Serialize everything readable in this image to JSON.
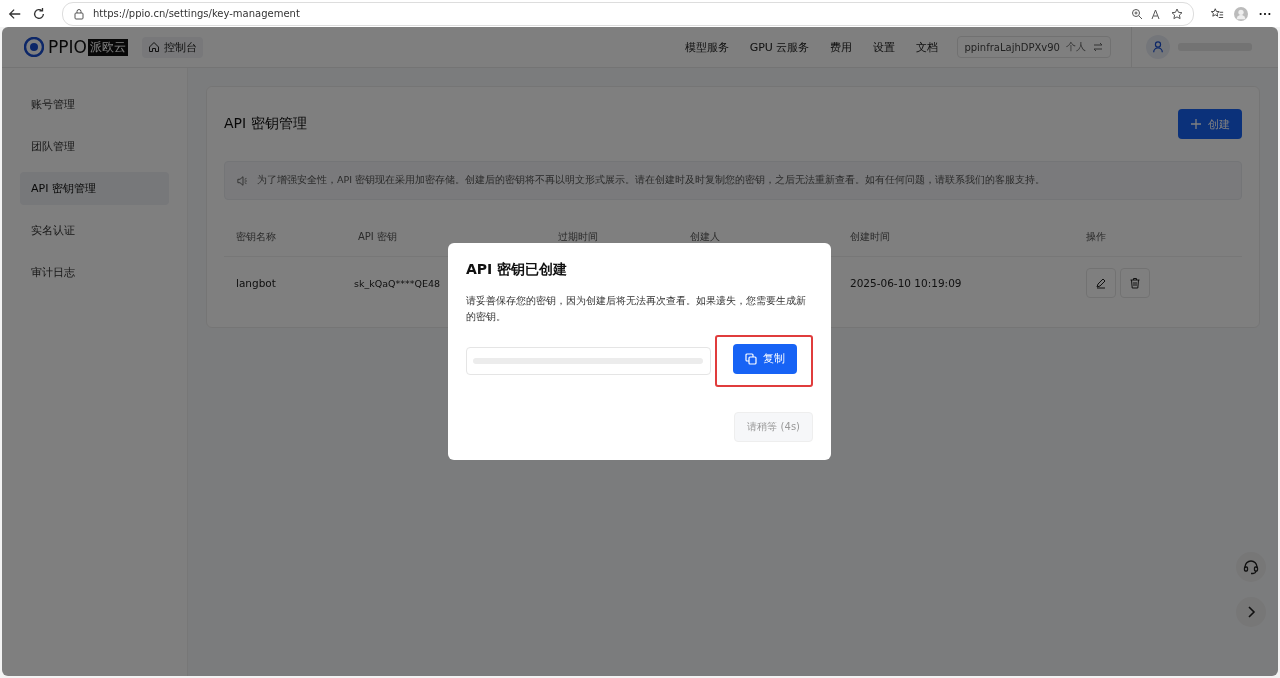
{
  "browser": {
    "url": "https://ppio.cn/settings/key-management"
  },
  "header": {
    "logo_text": "PPIO",
    "logo_badge": "派欧云",
    "console": "控制台",
    "nav": [
      "模型服务",
      "GPU 云服务",
      "费用",
      "设置",
      "文档"
    ],
    "account": {
      "name": "ppinfraLajhDPXv90",
      "type": "个人"
    }
  },
  "sidebar": {
    "items": [
      {
        "label": "账号管理",
        "selected": false
      },
      {
        "label": "团队管理",
        "selected": false
      },
      {
        "label": "API 密钥管理",
        "selected": true
      },
      {
        "label": "实名认证",
        "selected": false
      },
      {
        "label": "审计日志",
        "selected": false
      }
    ]
  },
  "page": {
    "title": "API 密钥管理",
    "create_button": "创建",
    "notice": "为了增强安全性，API 密钥现在采用加密存储。创建后的密钥将不再以明文形式展示。请在创建时及时复制您的密钥，之后无法重新查看。如有任何问题，请联系我们的客服支持。"
  },
  "table": {
    "columns": [
      "密钥名称",
      "API 密钥",
      "过期时间",
      "创建人",
      "创建时间",
      "操作"
    ],
    "rows": [
      {
        "name": "langbot",
        "key": "sk_kQaQ****QE48",
        "created": "2025-06-10 10:19:09"
      }
    ]
  },
  "dialog": {
    "title": "API 密钥已创建",
    "message": "请妥善保存您的密钥，因为创建后将无法再次查看。如果遗失，您需要生成新的密钥。",
    "copy_button": "复制",
    "wait_button": {
      "label": "请稍等 (4s)",
      "disabled": true
    }
  }
}
